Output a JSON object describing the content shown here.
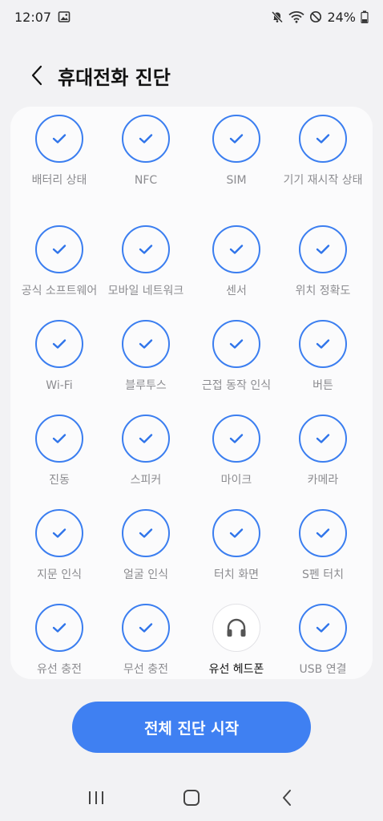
{
  "status_bar": {
    "time": "12:07",
    "battery_percent": "24%"
  },
  "header": {
    "title": "휴대전화 진단"
  },
  "tests": [
    {
      "label": "배터리 상태",
      "state": "passed"
    },
    {
      "label": "NFC",
      "state": "passed"
    },
    {
      "label": "SIM",
      "state": "passed"
    },
    {
      "label": "기기 재시작 상태",
      "state": "passed"
    },
    {
      "label": "공식 소프트웨어",
      "state": "passed"
    },
    {
      "label": "모바일 네트워크",
      "state": "passed"
    },
    {
      "label": "센서",
      "state": "passed"
    },
    {
      "label": "위치 정확도",
      "state": "passed"
    },
    {
      "label": "Wi-Fi",
      "state": "passed"
    },
    {
      "label": "블루투스",
      "state": "passed"
    },
    {
      "label": "근접 동작 인식",
      "state": "passed"
    },
    {
      "label": "버튼",
      "state": "passed"
    },
    {
      "label": "진동",
      "state": "passed"
    },
    {
      "label": "스피커",
      "state": "passed"
    },
    {
      "label": "마이크",
      "state": "passed"
    },
    {
      "label": "카메라",
      "state": "passed"
    },
    {
      "label": "지문 인식",
      "state": "passed"
    },
    {
      "label": "얼굴 인식",
      "state": "passed"
    },
    {
      "label": "터치 화면",
      "state": "passed"
    },
    {
      "label": "S펜 터치",
      "state": "passed"
    },
    {
      "label": "유선 충전",
      "state": "passed"
    },
    {
      "label": "무선 충전",
      "state": "passed"
    },
    {
      "label": "유선 헤드폰",
      "state": "not_tested",
      "icon": "headphones-icon"
    },
    {
      "label": "USB 연결",
      "state": "passed"
    }
  ],
  "start_button": {
    "label": "전체 진단 시작"
  },
  "colors": {
    "accent": "#3f80f2",
    "check": "#2f74ea",
    "label_muted": "#8c8c90"
  }
}
